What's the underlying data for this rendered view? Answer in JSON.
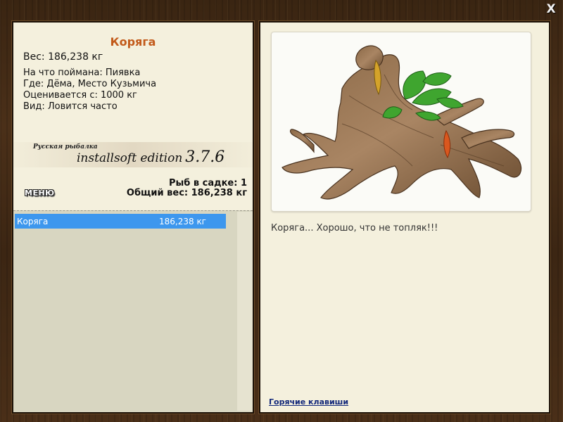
{
  "window": {
    "close_glyph": "X"
  },
  "fish": {
    "name": "Коряга",
    "weight_line": "Вес: 186,238 кг",
    "details": [
      "На что поймана: Пиявка",
      "Где: Дёма, Место Кузьмича",
      "Оценивается с: 1000 кг",
      "Вид: Ловится часто"
    ],
    "comment": "Коряга... Хорошо, что не топляк!!!",
    "image_icon": "driftwood-snag-with-leaves-and-lures"
  },
  "branding": {
    "small": "Русская рыбалка",
    "big": "installsoft edition",
    "version": "3.7.6"
  },
  "keepnet": {
    "count_line": "Рыб в садке: 1",
    "total_line": "Общий вес: 186,238 кг",
    "items": [
      {
        "name": "Коряга",
        "weight": "186,238 кг",
        "selected": true
      }
    ]
  },
  "menu_label": "МЕНЮ",
  "hotkeys_label": "Горячие клавиши",
  "colors": {
    "title": "#c25a1a",
    "selection": "#3d97ee",
    "link": "#12287a",
    "panel": "#f4f0dd",
    "wood": "#3f2814"
  }
}
